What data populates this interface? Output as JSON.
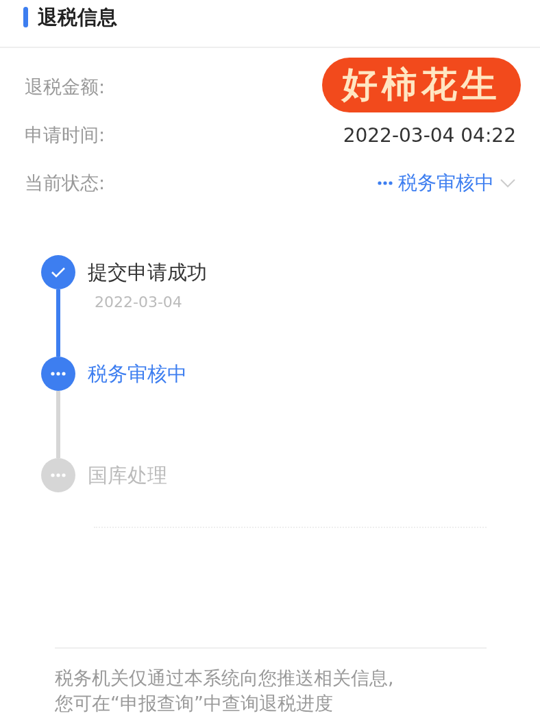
{
  "section_title": "退税信息",
  "sticker": {
    "text": "好柿花生"
  },
  "fields": [
    {
      "label": "退税金额:"
    },
    {
      "label": "申请时间:",
      "value": "2022-03-04 04:22"
    },
    {
      "label": "当前状态:",
      "value": "税务审核中",
      "kind": "status"
    }
  ],
  "steps": [
    {
      "title": "提交申请成功",
      "date": "2022-03-04",
      "kind": "done"
    },
    {
      "title": "税务审核中",
      "kind": "current"
    },
    {
      "title": "国库处理",
      "kind": "pending"
    }
  ],
  "footer_note": [
    "税务机关仅通过本系统向您推送相关信息,",
    "您可在“申报查询”中查询退税进度"
  ]
}
